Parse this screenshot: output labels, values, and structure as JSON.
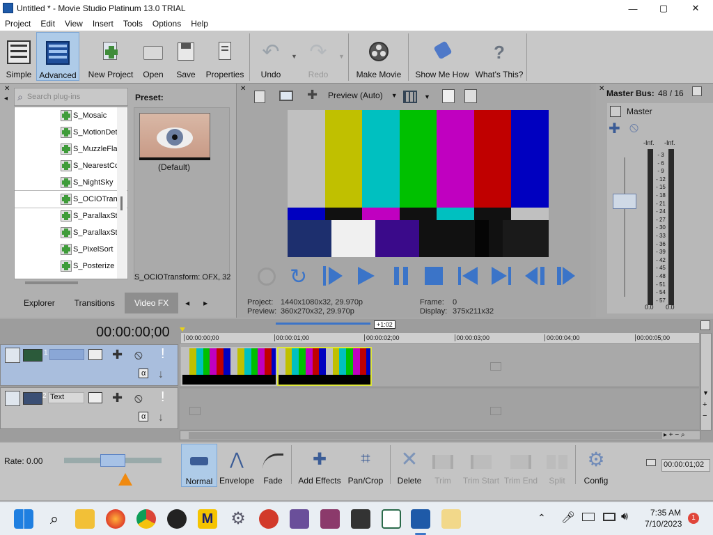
{
  "window": {
    "title": "Untitled * - Movie Studio Platinum 13.0 TRIAL",
    "min": "—",
    "max": "▢",
    "close": "✕"
  },
  "menu": [
    "Project",
    "Edit",
    "View",
    "Insert",
    "Tools",
    "Options",
    "Help"
  ],
  "toolbar": {
    "simple": "Simple",
    "advanced": "Advanced",
    "new_project": "New Project",
    "open": "Open",
    "save": "Save",
    "properties": "Properties",
    "undo": "Undo",
    "redo": "Redo",
    "make_movie": "Make Movie",
    "show_me_how": "Show Me How",
    "whats_this": "What's This?"
  },
  "plugins": {
    "search_placeholder": "Search plug-ins",
    "preset_label": "Preset:",
    "preset_name": "(Default)",
    "status": "S_OCIOTransform: OFX, 32",
    "items": [
      "S_Mosaic",
      "S_MotionDet",
      "S_MuzzleFlas",
      "S_NearestCo",
      "S_NightSky",
      "S_OCIOTran",
      "S_ParallaxSt",
      "S_ParallaxSt",
      "S_PixelSort",
      "S_Posterize"
    ],
    "selected_index": 5,
    "tabs": [
      "Explorer",
      "Transitions",
      "Video FX"
    ],
    "active_tab": "Video FX"
  },
  "preview": {
    "mode": "Preview (Auto)",
    "project_label": "Project:",
    "project_value": "1440x1080x32, 29.970p",
    "preview_label": "Preview:",
    "preview_value": "360x270x32, 29.970p",
    "frame_label": "Frame:",
    "frame_value": "0",
    "display_label": "Display:",
    "display_value": "375x211x32"
  },
  "mixer": {
    "title": "Master Bus:",
    "title_value": "48 / 16",
    "master": "Master",
    "inf_l": "-Inf.",
    "inf_r": "-Inf.",
    "scale": [
      "3",
      "6",
      "9",
      "12",
      "15",
      "18",
      "21",
      "24",
      "27",
      "30",
      "33",
      "36",
      "39",
      "42",
      "45",
      "48",
      "51",
      "54",
      "57"
    ],
    "bottom_l": "0.0",
    "bottom_r": "0.0"
  },
  "timeline": {
    "timecode": "00:00:00;00",
    "ruler": [
      "00:00:00;00",
      "00:00:01;00",
      "00:00:02;00",
      "00:00:03;00",
      "00:00:04;00",
      "00:00:05;00"
    ],
    "offset_badge": "+1:02",
    "track1_number": "1",
    "track2_number": "2",
    "track2_name": "Text",
    "rate": "Rate: 0.00",
    "end_timecode": "00:00:01;02"
  },
  "editbar": {
    "normal": "Normal",
    "envelope": "Envelope",
    "fade": "Fade",
    "add_effects": "Add Effects",
    "pan_crop": "Pan/Crop",
    "delete": "Delete",
    "trim": "Trim",
    "trim_start": "Trim Start",
    "trim_end": "Trim End",
    "split": "Split",
    "config": "Config"
  },
  "taskbar": {
    "time": "7:35 AM",
    "date": "7/10/2023",
    "notif": "1"
  },
  "colors": {
    "accent": "#3c78c8",
    "clip_border": "#dfe83a",
    "bars_top": [
      "#c0c0c0",
      "#c0c000",
      "#00c0c0",
      "#00c000",
      "#c000c0",
      "#c00000",
      "#0000c0"
    ]
  }
}
